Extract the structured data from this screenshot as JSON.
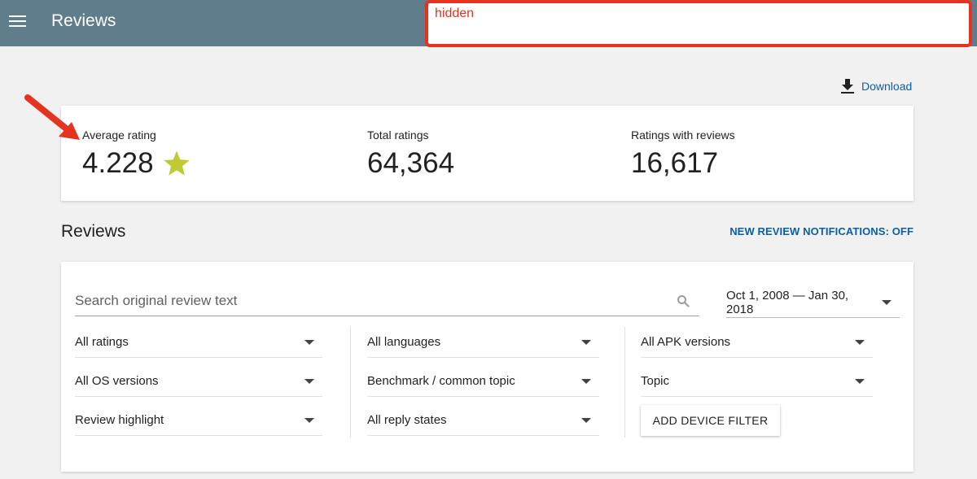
{
  "header": {
    "title": "Reviews",
    "redaction_text": "hidden"
  },
  "download": {
    "label": "Download"
  },
  "stats": [
    {
      "label": "Average rating",
      "value": "4.228"
    },
    {
      "label": "Total ratings",
      "value": "64,364"
    },
    {
      "label": "Ratings with reviews",
      "value": "16,617"
    }
  ],
  "reviews_section": {
    "title": "Reviews",
    "notifications_link": "NEW REVIEW NOTIFICATIONS: OFF"
  },
  "filters": {
    "search_placeholder": "Search original review text",
    "date_range": "Oct 1, 2008 — Jan 30, 2018",
    "col1": [
      "All ratings",
      "All OS versions",
      "Review highlight"
    ],
    "col2": [
      "All languages",
      "Benchmark / common topic",
      "All reply states"
    ],
    "col3": [
      "All APK versions",
      "Topic"
    ],
    "device_filter_button": "ADD DEVICE FILTER"
  },
  "colors": {
    "topbar": "#607d8b",
    "accent_link": "#0b5fa5",
    "star": "#c0ca33",
    "annotation": "#e53320"
  },
  "icons": [
    "menu-icon",
    "download-icon",
    "star-icon",
    "search-icon",
    "annotation-arrow"
  ]
}
